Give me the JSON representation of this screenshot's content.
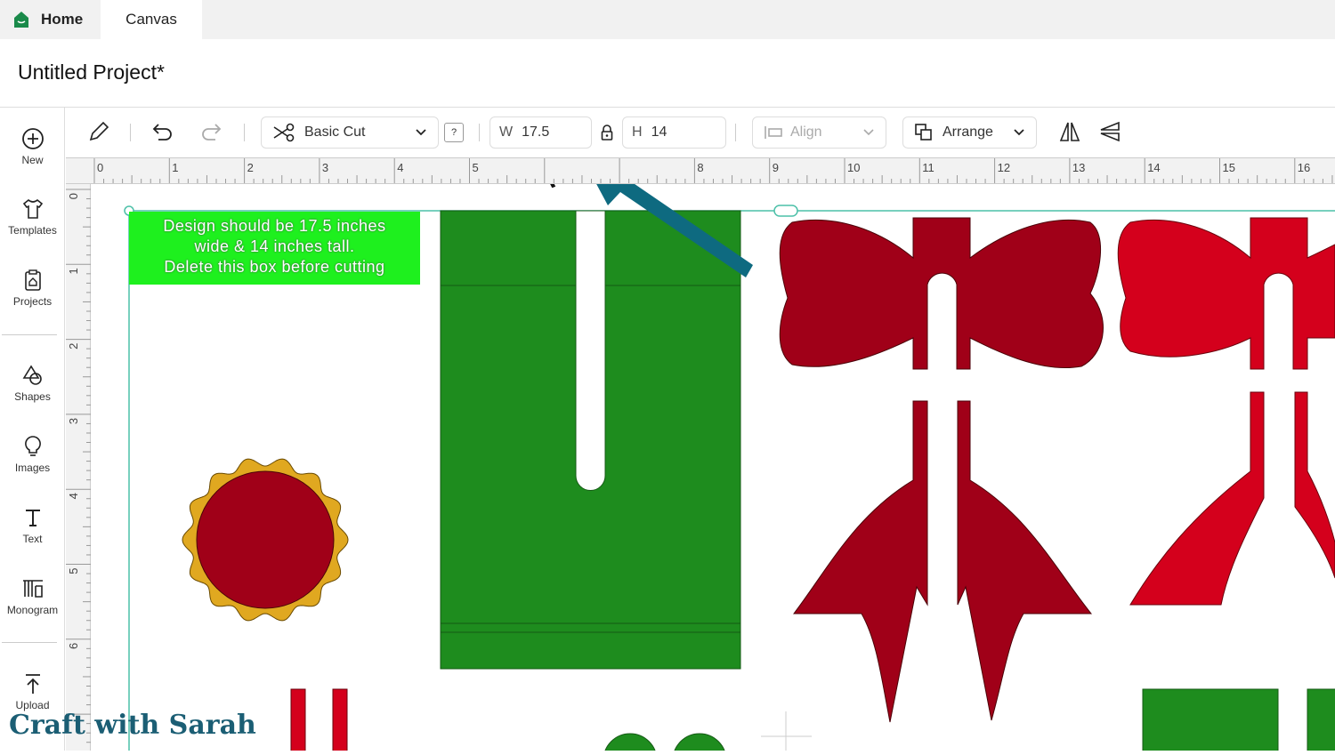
{
  "tabs": [
    {
      "label": "Home",
      "icon": "home-icon"
    },
    {
      "label": "Canvas"
    }
  ],
  "project_title": "Untitled Project*",
  "sidebar": {
    "items": [
      {
        "label": "New",
        "icon": "plus-circle-icon"
      },
      {
        "label": "Templates",
        "icon": "shirt-icon"
      },
      {
        "label": "Projects",
        "icon": "clipboard-icon"
      },
      {
        "label": "Shapes",
        "icon": "shapes-icon"
      },
      {
        "label": "Images",
        "icon": "lightbulb-icon"
      },
      {
        "label": "Text",
        "icon": "text-icon"
      },
      {
        "label": "Monogram",
        "icon": "monogram-icon"
      },
      {
        "label": "Upload",
        "icon": "upload-icon"
      }
    ]
  },
  "toolbar": {
    "operation": "Basic Cut",
    "help": "?",
    "width_label": "W",
    "width_value": "17.5",
    "height_label": "H",
    "height_value": "14",
    "align": "Align",
    "arrange": "Arrange"
  },
  "ruler": {
    "h": [
      "0",
      "1",
      "2",
      "3",
      "4",
      "5",
      "8",
      "9",
      "10",
      "11",
      "12",
      "13",
      "14",
      "15",
      "16"
    ],
    "v": [
      "0",
      "1",
      "2",
      "3",
      "4",
      "5",
      "6"
    ]
  },
  "canvas": {
    "note": [
      "Design should be 17.5 inches",
      "wide & 14 inches tall.",
      "Delete this box before cutting"
    ],
    "colors": {
      "green": "#1e8c1e",
      "dark_red": "#a00018",
      "red": "#d4001c",
      "gold": "#e0a820",
      "arrow": "#0e6a80",
      "note": "#1ef01e"
    }
  },
  "watermark": "Craft with Sarah"
}
